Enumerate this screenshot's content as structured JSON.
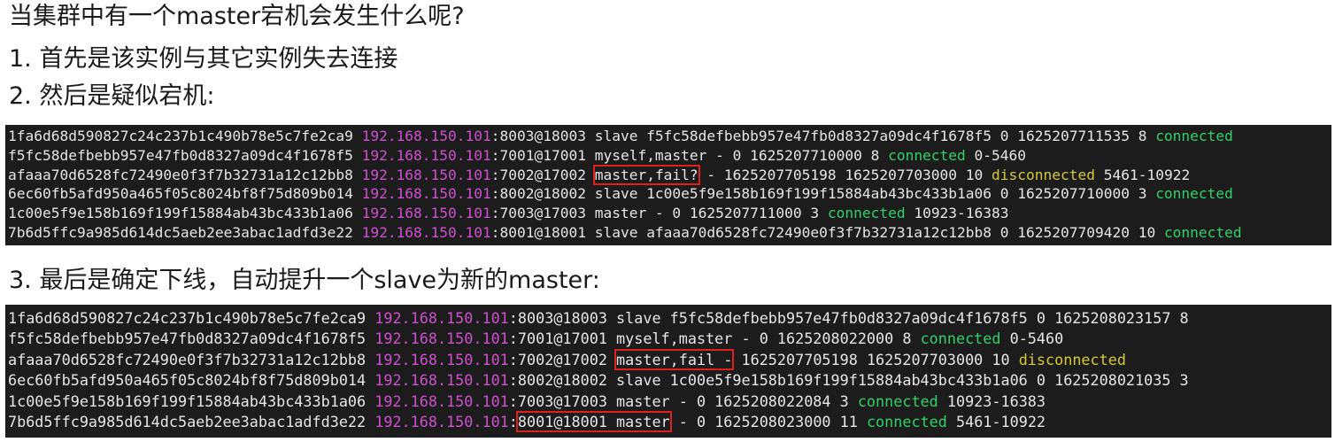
{
  "headings": {
    "question": "当集群中有一个master宕机会发生什么呢?",
    "step1": "1.  首先是该实例与其它实例失去连接",
    "step2": "2.  然后是疑似宕机:",
    "step3": "3.  最后是确定下线，自动提升一个slave为新的master:"
  },
  "colors": {
    "ip": "#d04fd0",
    "connected": "#2fd16b",
    "disconnected": "#d6c93a",
    "highlight_box": "#e02020",
    "terminal_bg": "#1c1c1c"
  },
  "terminal1": {
    "rows": [
      {
        "id": "1fa6d68d590827c24c237b1c490b78e5c7fe2ca9 ",
        "ip": "192.168.150.101",
        "port": ":8003@18003",
        "pre": " slave f5fc58defbebb957e47fb0d8327a09dc4f1678f5 0 1625207711535 8 ",
        "state": "connected",
        "post": ""
      },
      {
        "id": "f5fc58defbebb957e47fb0d8327a09dc4f1678f5 ",
        "ip": "192.168.150.101",
        "port": ":7001@17001",
        "pre": " myself,master - 0 1625207710000 8 ",
        "state": "connected",
        "post": " 0-5460"
      },
      {
        "id": "afaaa70d6528fc72490e0f3f7b32731a12c12bb8 ",
        "ip": "192.168.150.101",
        "port": ":7002@17002",
        "flag": "master,fail?",
        "pre": " - 1625207705198 1625207703000 10 ",
        "state": "disconnected",
        "post": " 5461-10922"
      },
      {
        "id": "6ec60fb5afd950a465f05c8024bf8f75d809b014 ",
        "ip": "192.168.150.101",
        "port": ":8002@18002",
        "pre": " slave 1c00e5f9e158b169f199f15884ab43bc433b1a06 0 1625207710000 3 ",
        "state": "connected",
        "post": ""
      },
      {
        "id": "1c00e5f9e158b169f199f15884ab43bc433b1a06 ",
        "ip": "192.168.150.101",
        "port": ":7003@17003",
        "pre": " master - 0 1625207711000 3 ",
        "state": "connected",
        "post": " 10923-16383"
      },
      {
        "id": "7b6d5ffc9a985d614dc5aeb2ee3abac1adfd3e22 ",
        "ip": "192.168.150.101",
        "port": ":8001@18001",
        "pre": " slave afaaa70d6528fc72490e0f3f7b32731a12c12bb8 0 1625207709420 10 ",
        "state": "connected",
        "post": ""
      }
    ]
  },
  "terminal2": {
    "rows": [
      {
        "id": "1fa6d68d590827c24c237b1c490b78e5c7fe2ca9 ",
        "ip": "192.168.150.101",
        "port": ":8003@18003",
        "pre": " slave f5fc58defbebb957e47fb0d8327a09dc4f1678f5 0 1625208023157 8",
        "state": "",
        "post": ""
      },
      {
        "id": "f5fc58defbebb957e47fb0d8327a09dc4f1678f5 ",
        "ip": "192.168.150.101",
        "port": ":7001@17001",
        "pre": " myself,master - 0 1625208022000 8 ",
        "state": "connected",
        "post": " 0-5460"
      },
      {
        "id": "afaaa70d6528fc72490e0f3f7b32731a12c12bb8 ",
        "ip": "192.168.150.101",
        "port": ":7002@17002",
        "flag": "master,fail -",
        "pre": " 1625207705198 1625207703000 10 ",
        "state": "disconnected",
        "post": ""
      },
      {
        "id": "6ec60fb5afd950a465f05c8024bf8f75d809b014 ",
        "ip": "192.168.150.101",
        "port": ":8002@18002",
        "pre": " slave 1c00e5f9e158b169f199f15884ab43bc433b1a06 0 1625208021035 3",
        "state": "",
        "post": ""
      },
      {
        "id": "1c00e5f9e158b169f199f15884ab43bc433b1a06 ",
        "ip": "192.168.150.101",
        "port": ":7003@17003",
        "pre": " master - 0 1625208022084 3 ",
        "state": "connected",
        "post": " 10923-16383"
      },
      {
        "id": "7b6d5ffc9a985d614dc5aeb2ee3abac1adfd3e22 ",
        "ip": "192.168.150.101",
        "port_prefix": ":",
        "promoted": "8001@18001 master",
        "pre": " - 0 1625208023000 11 ",
        "state": "connected",
        "post": " 5461-10922"
      }
    ]
  }
}
